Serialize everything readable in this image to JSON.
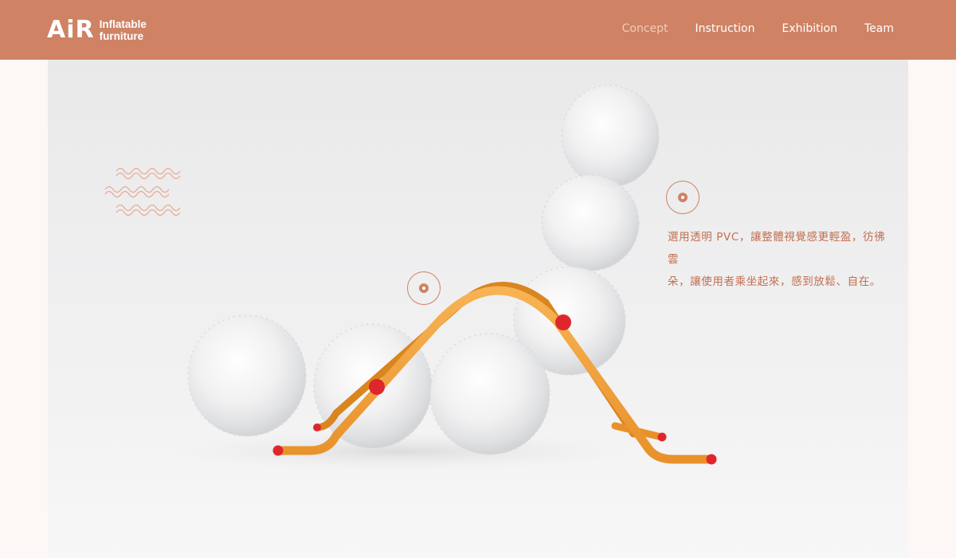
{
  "logo": {
    "mark": "AiR",
    "line1": "Inflatable",
    "line2": "furniture"
  },
  "nav": {
    "items": [
      {
        "label": "Concept",
        "active": true
      },
      {
        "label": "Instruction",
        "active": false
      },
      {
        "label": "Exhibition",
        "active": false
      },
      {
        "label": "Team",
        "active": false
      }
    ]
  },
  "hero": {
    "caption_line1": "選用透明 PVC，讓整體視覺感更輕盈，彷彿雲",
    "caption_line2": "朵，讓使用者乘坐起來，感到放鬆、自在。"
  },
  "colors": {
    "header_bg": "#cf8264",
    "accent": "#cf8264",
    "page_bg": "#fdf8f5",
    "frame_orange": "#f0a13e",
    "joint_red": "#e0262d"
  }
}
